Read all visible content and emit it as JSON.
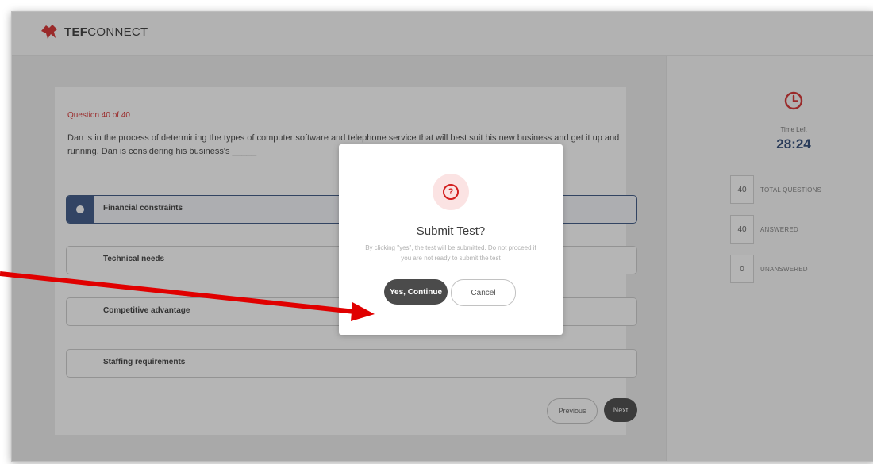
{
  "app": {
    "brand_bold": "TEF",
    "brand_rest": "CONNECT",
    "brand_color": "#d32020"
  },
  "question": {
    "counter": "Question 40 of 40",
    "text": "Dan is in the process of determining the types of computer software and telephone service that will best suit his new business and get it up and running. Dan is considering his business's _____"
  },
  "options": [
    {
      "label": "Financial constraints",
      "selected": true
    },
    {
      "label": "Technical needs",
      "selected": false
    },
    {
      "label": "Competitive advantage",
      "selected": false
    },
    {
      "label": "Staffing requirements",
      "selected": false
    }
  ],
  "nav": {
    "previous": "Previous",
    "next": "Next"
  },
  "timer": {
    "icon": "clock-icon",
    "label": "Time Left",
    "value": "28:24"
  },
  "stats": [
    {
      "count": "40",
      "label": "TOTAL QUESTIONS"
    },
    {
      "count": "40",
      "label": "ANSWERED"
    },
    {
      "count": "0",
      "label": "UNANSWERED"
    }
  ],
  "modal": {
    "icon": "question-circle-icon",
    "title": "Submit Test?",
    "message": "By clicking \"yes\", the test will be submitted. Do not proceed if you are not ready to submit the test",
    "confirm": "Yes, Continue",
    "cancel": "Cancel"
  },
  "annotation": {
    "arrow_color": "#e00000"
  }
}
